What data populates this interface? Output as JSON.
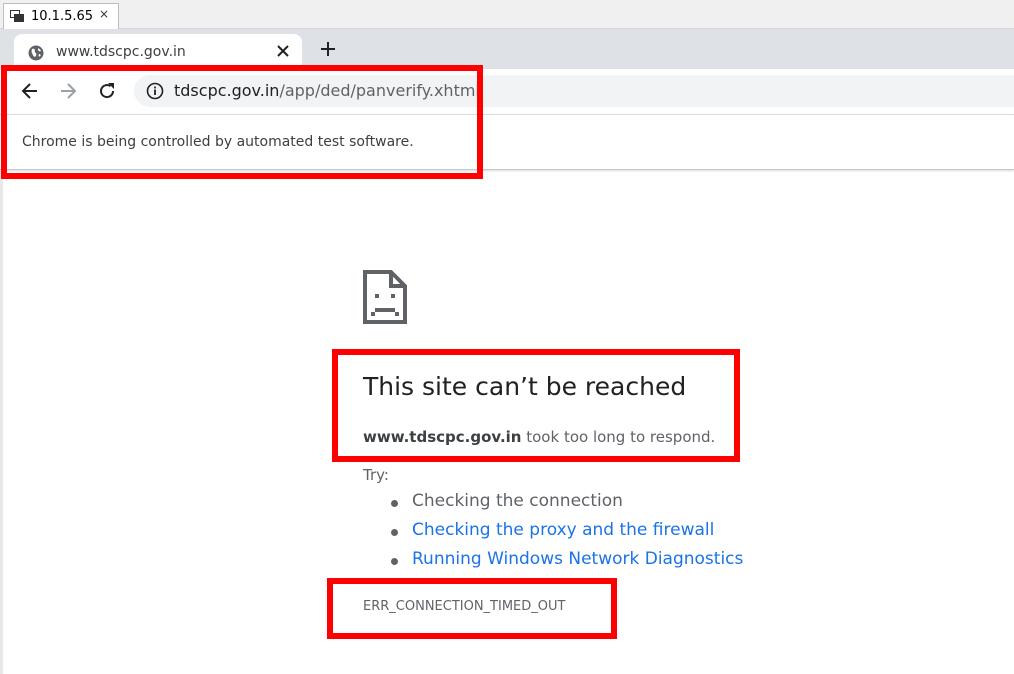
{
  "remote_window": {
    "title": "10.1.5.65",
    "close_glyph": "×"
  },
  "browser": {
    "tab": {
      "title": "www.tdscpc.gov.in",
      "favicon": "globe-icon",
      "close_icon": "close-icon"
    },
    "new_tab_icon": "plus-icon",
    "toolbar": {
      "back_icon": "back-arrow-icon",
      "forward_icon": "forward-arrow-icon",
      "reload_icon": "reload-icon",
      "security_icon": "info-icon",
      "url_host": "tdscpc.gov.in",
      "url_path": "/app/ded/panverify.xhtml"
    },
    "infobar_text": "Chrome is being controlled by automated test software."
  },
  "error_page": {
    "icon": "sad-page-icon",
    "heading": "This site can’t be reached",
    "host": "www.tdscpc.gov.in",
    "message": " took too long to respond.",
    "try_label": "Try:",
    "suggestions": [
      {
        "text": "Checking the connection",
        "link": false
      },
      {
        "text": "Checking the proxy and the firewall",
        "link": true
      },
      {
        "text": "Running Windows Network Diagnostics",
        "link": true
      }
    ],
    "error_code": "ERR_CONNECTION_TIMED_OUT"
  },
  "annotations": {
    "highlight_color": "#ff0000"
  },
  "colors": {
    "link": "#1a73e8",
    "tabstrip": "#dee1e6",
    "omnibox": "#f1f3f4"
  }
}
